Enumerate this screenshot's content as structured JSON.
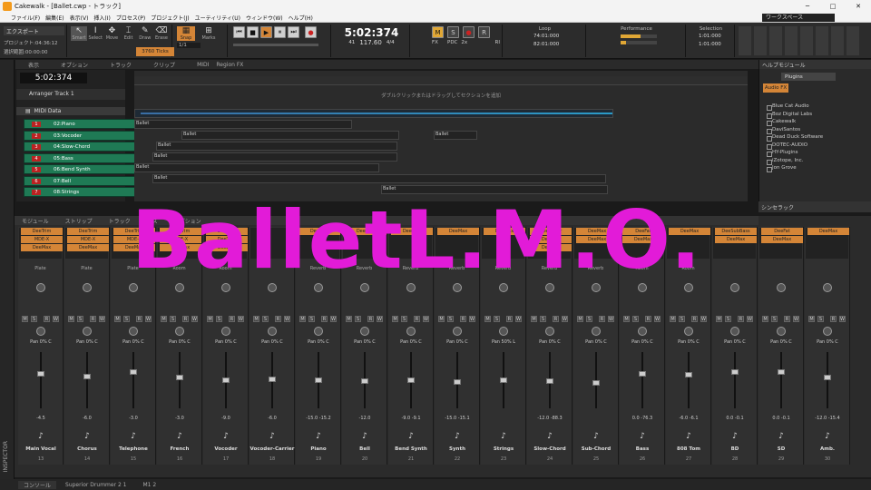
{
  "window": {
    "title": "Cakewalk - [Ballet.cwp - トラック]",
    "controls": [
      "─",
      "□",
      "✕"
    ]
  },
  "menu": [
    "ファイル(F)",
    "編集(E)",
    "表示(V)",
    "挿入(I)",
    "プロセス(P)",
    "プロジェクト(J)",
    "ユーティリティ(U)",
    "ウィンドウ(W)",
    "ヘルプ(H)"
  ],
  "workspace": "ワークスペース",
  "control": {
    "export_label": "エクスポート",
    "project_label": "プロジェクト:04:36:12",
    "selection_label": "選択範囲:00:00:00",
    "tools": [
      "Smart",
      "Select",
      "Move",
      "Edit",
      "Draw",
      "Erase"
    ],
    "snap_label": "Snap",
    "snap_value": "1/1",
    "marks_label": "Marks",
    "ticks": "3760 Ticks",
    "time": "5:02:374",
    "bars": "41",
    "beats": "32",
    "tempo": "117.60",
    "meter": "4/4",
    "loop_label": "Loop",
    "loop_start": "74:01:000",
    "loop_end": "82:01:000",
    "performance_label": "Performance",
    "selection_title": "Selection",
    "sel_start": "1:01:000",
    "sel_end": "1:01:000",
    "fx_label": "FX",
    "pdc_label": "PDC",
    "x2": "2x",
    "m": "M",
    "ri": "RI"
  },
  "trackview": {
    "menu": [
      "表示",
      "オプション",
      "トラック",
      "クリップ",
      "MIDI",
      "Region FX"
    ],
    "now_time": "5:02:374",
    "arranger": "Arranger Track 1",
    "hint": "ダブルクリックまたはドラッグしてセクションを追加",
    "midi_folder": "MIDI Data",
    "tracks": [
      {
        "num": "1",
        "name": "02:Piano"
      },
      {
        "num": "2",
        "name": "03:Vocoder"
      },
      {
        "num": "3",
        "name": "04:Slow-Chord"
      },
      {
        "num": "4",
        "name": "05:Bass"
      },
      {
        "num": "5",
        "name": "06:Bend Synth"
      },
      {
        "num": "6",
        "name": "07:Bell"
      },
      {
        "num": "7",
        "name": "08:Strings"
      }
    ],
    "clips": [
      "Ballet",
      "Ballet",
      "Ballet",
      "Ballet",
      "Ballet",
      "Ballet",
      "Ballet",
      "Ballet",
      "Ballet",
      "Ballet"
    ]
  },
  "browser": {
    "title": "ヘルプモジュール",
    "tab": "Plugins",
    "audio_fx": "Audio FX",
    "items": [
      "Blue Cat Audio",
      "Boz Digital Labs",
      "Cakewalk",
      "DaviSantos",
      "Dead Duck Software",
      "DOTEC-AUDIO",
      "HY-Plugins",
      "iZotope, Inc.",
      "Jon Grove"
    ],
    "synth_rack": "シンセラック"
  },
  "console": {
    "menu": [
      "モジュール",
      "ストリップ",
      "トラック",
      "バス",
      "オプション"
    ],
    "strips": [
      {
        "name": "Main Vocal",
        "num": "13",
        "fx": [
          "DeeTrim",
          "MDE-X",
          "DeeMax"
        ],
        "send": "Plate",
        "gain": "-4.5",
        "pan": "Pan 0% C",
        "f": 0.62
      },
      {
        "name": "Chorus",
        "num": "14",
        "fx": [
          "DeeTrim",
          "MDE-X",
          "DeeMax"
        ],
        "send": "Plate",
        "gain": "-6.0",
        "pan": "Pan 0% C",
        "f": 0.58
      },
      {
        "name": "Telephone",
        "num": "15",
        "fx": [
          "DeeTrim",
          "MDE-X",
          "DeeMax"
        ],
        "send": "Plate",
        "gain": "-3.0",
        "pan": "Pan 0% C",
        "f": 0.66
      },
      {
        "name": "French",
        "num": "16",
        "fx": [
          "DeeTrim",
          "MDE-X",
          "DeeMax"
        ],
        "send": "Room",
        "gain": "-3.0",
        "pan": "Pan 0% C",
        "f": 0.55
      },
      {
        "name": "Vocoder",
        "num": "17",
        "fx": [
          "DeeTrim",
          "DeeTrim",
          "DeeMax"
        ],
        "send": "Room",
        "gain": "-9.0",
        "pan": "Pan 0% C",
        "f": 0.5
      },
      {
        "name": "Vocoder-Carrier",
        "num": "18",
        "fx": [],
        "send": "",
        "gain": "-6.0",
        "pan": "Pan 0% C",
        "f": 0.52
      },
      {
        "name": "Piano",
        "num": "19",
        "fx": [
          "DeeMax"
        ],
        "send": "Reverb",
        "gain": "-15.0 -15.2",
        "pan": "Pan 0% C",
        "f": 0.5
      },
      {
        "name": "Bell",
        "num": "20",
        "fx": [
          "DeeMax"
        ],
        "send": "Reverb",
        "gain": "-12.0",
        "pan": "Pan 0% C",
        "f": 0.48
      },
      {
        "name": "Bend Synth",
        "num": "21",
        "fx": [
          "DeeMax"
        ],
        "send": "Reverb",
        "gain": "-9.0 -9.1",
        "pan": "Pan 0% C",
        "f": 0.5
      },
      {
        "name": "Synth",
        "num": "22",
        "fx": [
          "DeeMax"
        ],
        "send": "Reverb",
        "gain": "-15.0 -15.1",
        "pan": "Pan 0% C",
        "f": 0.46
      },
      {
        "name": "Strings",
        "num": "23",
        "fx": [
          "DeeMax"
        ],
        "send": "Reverb",
        "gain": "",
        "pan": "Pan 50% L",
        "f": 0.5
      },
      {
        "name": "Slow-Chord",
        "num": "24",
        "fx": [
          "DeeWider",
          "DeeMax",
          "DeeMax"
        ],
        "send": "Reverb",
        "gain": "-12.0 -88.3",
        "pan": "Pan 0% C",
        "f": 0.48
      },
      {
        "name": "Sub-Chord",
        "num": "25",
        "fx": [
          "DeeMax",
          "DeeMax"
        ],
        "send": "Reverb",
        "gain": "",
        "pan": "Pan 0% C",
        "f": 0.44
      },
      {
        "name": "Bass",
        "num": "26",
        "fx": [
          "DeeFat",
          "DeeMax"
        ],
        "send": "Room",
        "gain": "0.0 -76.3",
        "pan": "Pan 0% C",
        "f": 0.62
      },
      {
        "name": "808 Tom",
        "num": "27",
        "fx": [
          "DeeMax"
        ],
        "send": "Room",
        "gain": "-6.0 -6.1",
        "pan": "Pan 0% C",
        "f": 0.6
      },
      {
        "name": "BD",
        "num": "28",
        "fx": [
          "DeeSubBass",
          "DeeMax"
        ],
        "send": "",
        "gain": "0.0 -0.1",
        "pan": "Pan 0% C",
        "f": 0.66
      },
      {
        "name": "SD",
        "num": "29",
        "fx": [
          "DeeFat",
          "DeeMax"
        ],
        "send": "",
        "gain": "0.0 -0.1",
        "pan": "Pan 0% C",
        "f": 0.66
      },
      {
        "name": "Amb.",
        "num": "30",
        "fx": [
          "DeeMax"
        ],
        "send": "",
        "gain": "-12.0 -15.4",
        "pan": "Pan 0% C",
        "f": 0.56
      }
    ]
  },
  "bottom_tabs": [
    "コンソール",
    "Superior Drummer 2 1",
    "M1 2"
  ],
  "inspector": "INSPECTOR",
  "overlay_text": "BalletL.M.O."
}
